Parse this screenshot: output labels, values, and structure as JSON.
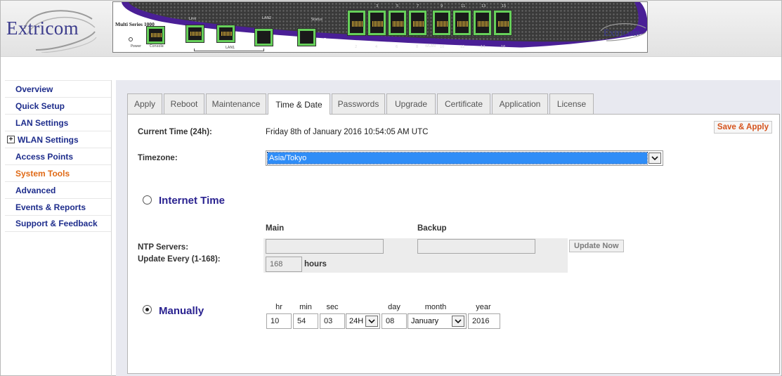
{
  "header": {
    "brand": "Extricom",
    "device": {
      "series": "Multi Series 1000",
      "labels": {
        "power": "Power",
        "console": "Console",
        "link": "Link",
        "lan2": "LAN2",
        "status": "Status",
        "lan1": "LAN1",
        "wlan": "WLAN",
        "port_numbers_top": [
          "3",
          "5",
          "7",
          "9",
          "11",
          "13",
          "15"
        ],
        "port_numbers_bottom": [
          "2",
          "4",
          "6",
          "8",
          "10",
          "12",
          "14",
          "16"
        ]
      }
    }
  },
  "sidebar": {
    "items": [
      {
        "label": "Overview"
      },
      {
        "label": "Quick Setup"
      },
      {
        "label": "LAN Settings"
      },
      {
        "label": "WLAN Settings",
        "expand_icon": "+"
      },
      {
        "label": "Access Points"
      },
      {
        "label": "System Tools",
        "active": true
      },
      {
        "label": "Advanced"
      },
      {
        "label": "Events & Reports"
      },
      {
        "label": "Support & Feedback"
      }
    ]
  },
  "tabs": [
    {
      "label": "Apply"
    },
    {
      "label": "Reboot"
    },
    {
      "label": "Maintenance"
    },
    {
      "label": "Time & Date",
      "active": true
    },
    {
      "label": "Passwords"
    },
    {
      "label": "Upgrade"
    },
    {
      "label": "Certificate"
    },
    {
      "label": "Application"
    },
    {
      "label": "License"
    }
  ],
  "form": {
    "save_apply_label": "Save & Apply",
    "current_time_label": "Current Time (24h):",
    "current_time_value": "Friday 8th of January 2016 10:54:05 AM UTC",
    "timezone_label": "Timezone:",
    "timezone_value": "Asia/Tokyo",
    "internet_time": {
      "title": "Internet Time",
      "selected": false,
      "main_header": "Main",
      "backup_header": "Backup",
      "ntp_label": "NTP Servers:",
      "ntp_main_value": "",
      "ntp_backup_value": "",
      "update_now_label": "Update Now",
      "update_every_label": "Update Every (1-168):",
      "update_every_value": "168",
      "hours_label": "hours"
    },
    "manually": {
      "title": "Manually",
      "selected": true,
      "hr_label": "hr",
      "min_label": "min",
      "sec_label": "sec",
      "day_label": "day",
      "month_label": "month",
      "year_label": "year",
      "hr_value": "10",
      "min_value": "54",
      "sec_value": "03",
      "format_value": "24H",
      "day_value": "08",
      "month_value": "January",
      "year_value": "2016"
    }
  },
  "colors": {
    "nav_text": "#1e2d8c",
    "nav_active": "#e06a16",
    "section_title": "#2a2290",
    "save_text": "#d5531c",
    "selection_bg": "#2f8df7",
    "device_purple": "#4a1f96",
    "port_green": "#66d05a"
  }
}
